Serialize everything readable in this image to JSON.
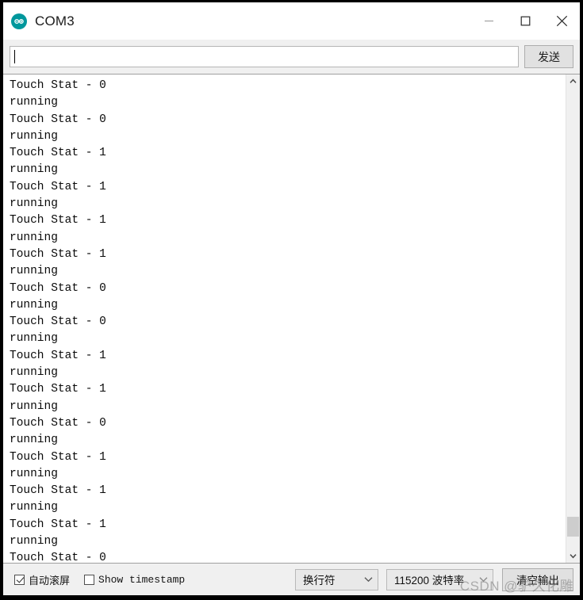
{
  "window": {
    "title": "COM3",
    "app_icon": "arduino-infinity-icon",
    "controls": {
      "minimize": "minimize-icon",
      "maximize": "maximize-icon",
      "close": "close-icon"
    }
  },
  "send_bar": {
    "input_value": "",
    "input_placeholder": "",
    "send_label": "发送"
  },
  "console": {
    "lines": [
      "Touch Stat - 0",
      "running",
      "Touch Stat - 0",
      "running",
      "Touch Stat - 1",
      "running",
      "Touch Stat - 1",
      "running",
      "Touch Stat - 1",
      "running",
      "Touch Stat - 1",
      "running",
      "Touch Stat - 0",
      "running",
      "Touch Stat - 0",
      "running",
      "Touch Stat - 1",
      "running",
      "Touch Stat - 1",
      "running",
      "Touch Stat - 0",
      "running",
      "Touch Stat - 1",
      "running",
      "Touch Stat - 1",
      "running",
      "Touch Stat - 1",
      "running",
      "Touch Stat - 0"
    ]
  },
  "scrollbar": {
    "up_arrow": "chevron-up-icon",
    "down_arrow": "chevron-down-icon",
    "thumb_top_pct": 93.0,
    "thumb_height_pct": 4.2
  },
  "status_bar": {
    "autoscroll_label": "自动滚屏",
    "autoscroll_checked": true,
    "timestamp_label": "Show timestamp",
    "timestamp_checked": false,
    "newline_value": "换行符",
    "baud_value": "115200 波特率",
    "clear_label": "清空输出",
    "chevron_icon": "chevron-down-icon"
  },
  "watermark": {
    "text": "CSDN @驴久化雕"
  },
  "colors": {
    "accent": "#00979c",
    "window_bg": "#ffffff",
    "chrome_bg": "#f0f0f0",
    "text": "#0a0a0a"
  }
}
